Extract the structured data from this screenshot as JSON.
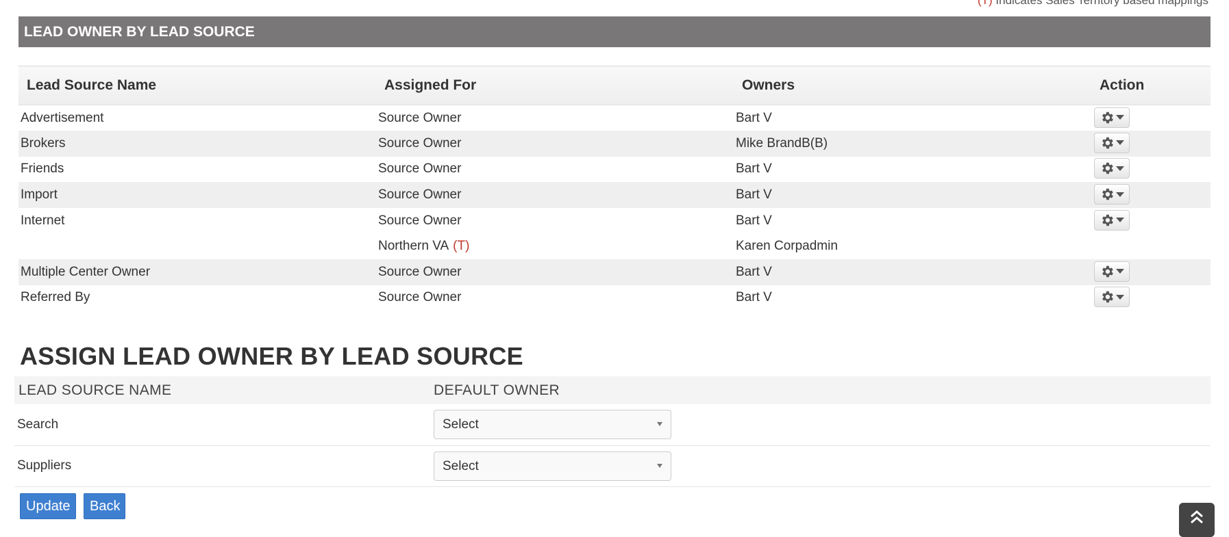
{
  "note": {
    "mark": "(T)",
    "text": " Indicates Sales Territory based mappings"
  },
  "banner": {
    "title": "LEAD OWNER BY LEAD SOURCE"
  },
  "owner_table": {
    "headers": [
      "Lead Source Name",
      "Assigned For",
      "Owners",
      "Action"
    ],
    "rows": [
      {
        "source": "Advertisement",
        "assigned": "Source Owner",
        "owner": "Bart V"
      },
      {
        "source": "Brokers",
        "assigned": "Source Owner",
        "owner": "Mike BrandB(B)"
      },
      {
        "source": "Friends",
        "assigned": "Source Owner",
        "owner": "Bart V"
      },
      {
        "source": "Import",
        "assigned": "Source Owner",
        "owner": "Bart V"
      },
      {
        "source": "Internet",
        "assigned": "Source Owner",
        "owner": "Bart V"
      },
      {
        "source": "",
        "assigned": "Northern VA",
        "mark": "(T)",
        "owner": "Karen Corpadmin"
      },
      {
        "source": "Multiple Center Owner",
        "assigned": "Source Owner",
        "owner": "Bart V"
      },
      {
        "source": "Referred By",
        "assigned": "Source Owner",
        "owner": "Bart V"
      }
    ]
  },
  "assign": {
    "heading": "ASSIGN LEAD OWNER BY LEAD SOURCE",
    "headers": [
      "LEAD SOURCE NAME",
      "DEFAULT OWNER"
    ],
    "rows": [
      {
        "name": "Search",
        "select": "Select"
      },
      {
        "name": "Suppliers",
        "select": "Select"
      }
    ]
  },
  "buttons": {
    "update": "Update",
    "back": "Back"
  },
  "colors": {
    "banner": "#7a7778",
    "button": "#3f7fd0",
    "territory_mark": "#c0392b"
  },
  "icons": {
    "action": "gear-icon",
    "scroll": "double-chevron-up-icon"
  }
}
